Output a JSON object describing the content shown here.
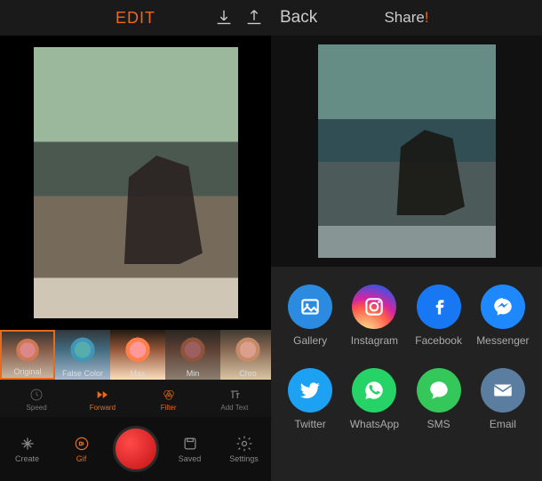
{
  "left": {
    "title": "EDIT",
    "filters": [
      {
        "label": "Original"
      },
      {
        "label": "False Color"
      },
      {
        "label": "Max"
      },
      {
        "label": "Min"
      },
      {
        "label": "Chro"
      }
    ],
    "tools": {
      "speed": "Speed",
      "forward": "Forward",
      "filter": "Filter",
      "addtext": "Add Text"
    },
    "bottom": {
      "create": "Create",
      "gif": "Gif",
      "saved": "Saved",
      "settings": "Settings"
    }
  },
  "right": {
    "back": "Back",
    "title": "Share",
    "accent": "!",
    "share": [
      {
        "key": "gallery",
        "label": "Gallery"
      },
      {
        "key": "instagram",
        "label": "Instagram"
      },
      {
        "key": "facebook",
        "label": "Facebook"
      },
      {
        "key": "messenger",
        "label": "Messenger"
      },
      {
        "key": "twitter",
        "label": "Twitter"
      },
      {
        "key": "whatsapp",
        "label": "WhatsApp"
      },
      {
        "key": "sms",
        "label": "SMS"
      },
      {
        "key": "email",
        "label": "Email"
      }
    ]
  }
}
